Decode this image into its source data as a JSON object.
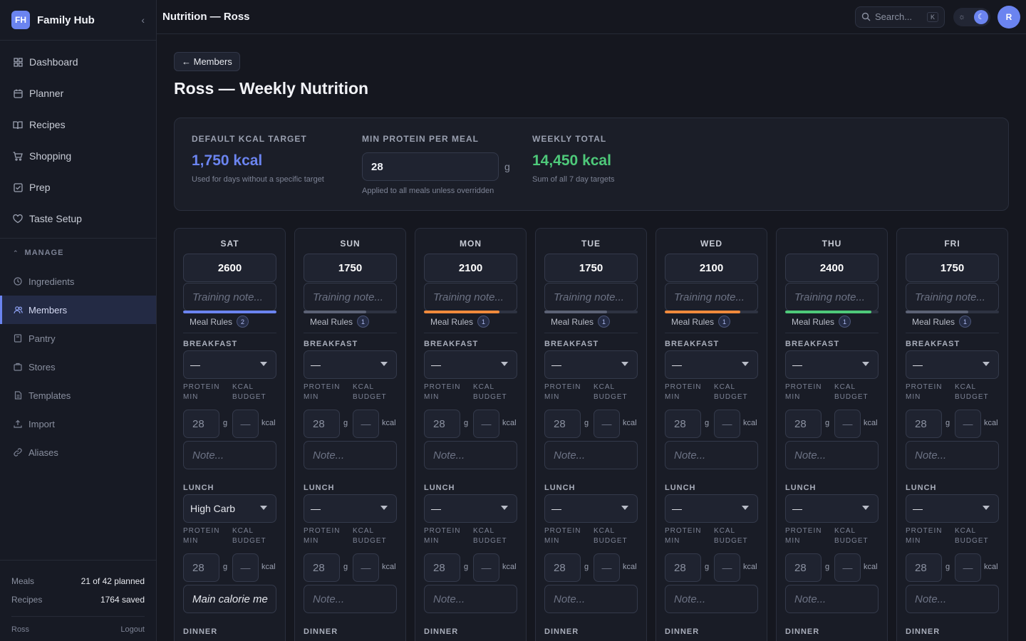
{
  "brand": {
    "logo": "FH",
    "name": "Family Hub"
  },
  "nav": [
    {
      "label": "Dashboard",
      "icon": "grid-icon"
    },
    {
      "label": "Planner",
      "icon": "calendar-icon"
    },
    {
      "label": "Recipes",
      "icon": "book-icon"
    },
    {
      "label": "Shopping",
      "icon": "cart-icon"
    },
    {
      "label": "Prep",
      "icon": "checkbox-icon"
    },
    {
      "label": "Taste Setup",
      "icon": "heart-icon"
    }
  ],
  "manage": {
    "heading": "MANAGE",
    "items": [
      {
        "label": "Ingredients",
        "icon": "leaf-icon",
        "active": false
      },
      {
        "label": "Members",
        "icon": "users-icon",
        "active": true
      },
      {
        "label": "Pantry",
        "icon": "box-icon",
        "active": false
      },
      {
        "label": "Stores",
        "icon": "store-icon",
        "active": false
      },
      {
        "label": "Templates",
        "icon": "document-icon",
        "active": false
      },
      {
        "label": "Import",
        "icon": "upload-icon",
        "active": false
      },
      {
        "label": "Aliases",
        "icon": "link-icon",
        "active": false
      }
    ]
  },
  "footer": {
    "meals_label": "Meals",
    "meals_value": "21 of 42 planned",
    "recipes_label": "Recipes",
    "recipes_value": "1764 saved",
    "user": "Ross",
    "logout": "Logout"
  },
  "topbar": {
    "title": "Nutrition — Ross",
    "search_placeholder": "Search...",
    "search_kbd": "K",
    "avatar": "R"
  },
  "page": {
    "back_label": "← Members",
    "title": "Ross — Weekly Nutrition"
  },
  "summary": {
    "default_label": "DEFAULT KCAL TARGET",
    "default_value": "1,750 kcal",
    "default_hint": "Used for days without a specific target",
    "protein_label": "MIN PROTEIN PER MEAL",
    "protein_value": "28",
    "protein_unit": "g",
    "protein_hint": "Applied to all meals unless overridden",
    "weekly_label": "WEEKLY TOTAL",
    "weekly_value": "14,450 kcal",
    "weekly_hint": "Sum of all 7 day targets"
  },
  "colors": {
    "accent": "#6b84f0",
    "green": "#4ec97a",
    "orange": "#f08a3c",
    "grey": "#5c6275"
  },
  "labels": {
    "training_placeholder": "Training note...",
    "meal_rules": "Meal Rules",
    "breakfast": "BREAKFAST",
    "lunch": "LUNCH",
    "dinner": "DINNER",
    "protein_min_1": "PROTEIN",
    "protein_min_2": "MIN",
    "kcal_budget_1": "KCAL",
    "kcal_budget_2": "BUDGET",
    "g": "g",
    "kcal": "kcal",
    "note_placeholder": "Note..."
  },
  "days": [
    {
      "name": "SAT",
      "kcal": "2600",
      "bar_color": "#6b84f0",
      "bar_pct": 100,
      "rules": "2",
      "breakfast": {
        "select": "—",
        "protein": "28",
        "budget": "—",
        "note": ""
      },
      "lunch": {
        "select": "High Carb",
        "protein": "28",
        "budget": "—",
        "note": "Main calorie me"
      }
    },
    {
      "name": "SUN",
      "kcal": "1750",
      "bar_color": "#5c6275",
      "bar_pct": 67,
      "rules": "1",
      "breakfast": {
        "select": "—",
        "protein": "28",
        "budget": "—",
        "note": ""
      },
      "lunch": {
        "select": "—",
        "protein": "28",
        "budget": "—",
        "note": ""
      }
    },
    {
      "name": "MON",
      "kcal": "2100",
      "bar_color": "#f08a3c",
      "bar_pct": 81,
      "rules": "1",
      "breakfast": {
        "select": "—",
        "protein": "28",
        "budget": "—",
        "note": ""
      },
      "lunch": {
        "select": "—",
        "protein": "28",
        "budget": "—",
        "note": ""
      }
    },
    {
      "name": "TUE",
      "kcal": "1750",
      "bar_color": "#5c6275",
      "bar_pct": 67,
      "rules": "1",
      "breakfast": {
        "select": "—",
        "protein": "28",
        "budget": "—",
        "note": ""
      },
      "lunch": {
        "select": "—",
        "protein": "28",
        "budget": "—",
        "note": ""
      }
    },
    {
      "name": "WED",
      "kcal": "2100",
      "bar_color": "#f08a3c",
      "bar_pct": 81,
      "rules": "1",
      "breakfast": {
        "select": "—",
        "protein": "28",
        "budget": "—",
        "note": ""
      },
      "lunch": {
        "select": "—",
        "protein": "28",
        "budget": "—",
        "note": ""
      }
    },
    {
      "name": "THU",
      "kcal": "2400",
      "bar_color": "#4ec97a",
      "bar_pct": 92,
      "rules": "1",
      "breakfast": {
        "select": "—",
        "protein": "28",
        "budget": "—",
        "note": ""
      },
      "lunch": {
        "select": "—",
        "protein": "28",
        "budget": "—",
        "note": ""
      }
    },
    {
      "name": "FRI",
      "kcal": "1750",
      "bar_color": "#5c6275",
      "bar_pct": 67,
      "rules": "1",
      "breakfast": {
        "select": "—",
        "protein": "28",
        "budget": "—",
        "note": ""
      },
      "lunch": {
        "select": "—",
        "protein": "28",
        "budget": "—",
        "note": ""
      }
    }
  ]
}
